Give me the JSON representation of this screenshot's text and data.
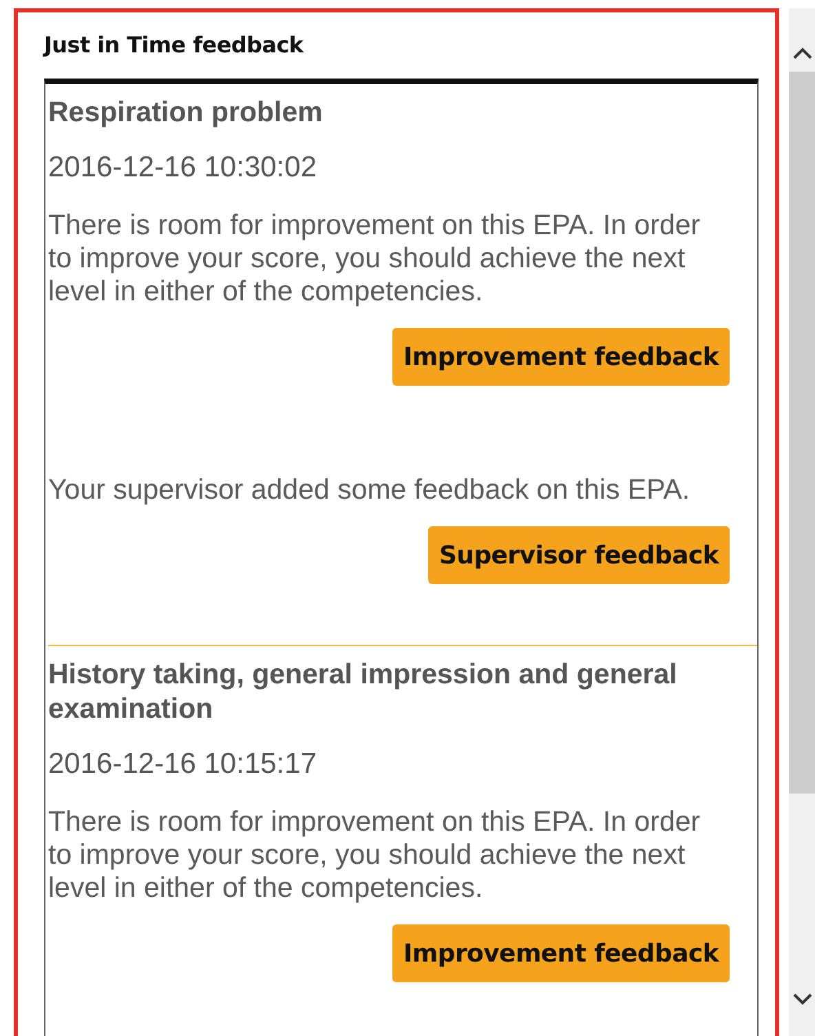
{
  "panel": {
    "title": "Just in Time feedback"
  },
  "entries": [
    {
      "title": "Respiration problem",
      "timestamp": "2016-12-16 10:30:02",
      "messages": [
        {
          "text": "There is room for improvement on this EPA. In order to improve your score, you should achieve the next level in either of the competencies.",
          "button": "Improvement feedback"
        },
        {
          "text": "Your supervisor added some feedback on this EPA.",
          "button": "Supervisor feedback"
        }
      ]
    },
    {
      "title": "History taking, general impression and general examination",
      "timestamp": "2016-12-16 10:15:17",
      "messages": [
        {
          "text": "There is room for improvement on this EPA. In order to improve your score, you should achieve the next level in either of the competencies.",
          "button": "Improvement feedback"
        }
      ]
    }
  ]
}
